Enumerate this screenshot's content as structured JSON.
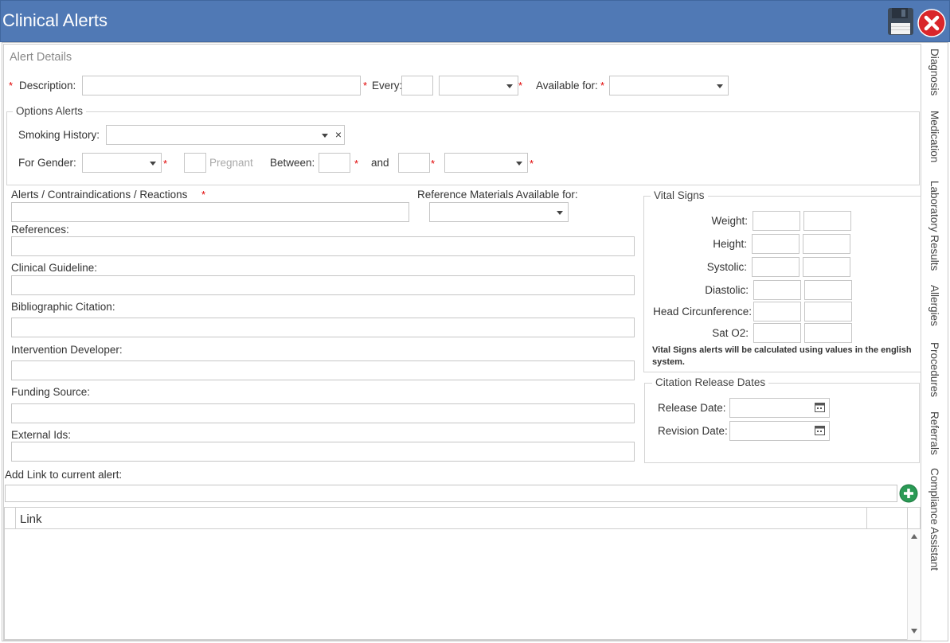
{
  "window": {
    "title": "Clinical Alerts"
  },
  "alert_details": {
    "heading": "Alert Details",
    "description_label": "Description:",
    "every_label": "Every:",
    "available_for_label": "Available for:",
    "required_mark": "*"
  },
  "options_alerts": {
    "legend": "Options Alerts",
    "smoking_history_label": "Smoking History:",
    "clear_symbol": "×",
    "for_gender_label": "For Gender:",
    "pregnant_label": "Pregnant",
    "between_label": "Between:",
    "and_label": "and"
  },
  "fields": {
    "alerts_label": "Alerts / Contraindications / Reactions",
    "reference_materials_label": "Reference Materials Available for:",
    "references_label": "References:",
    "clinical_guideline_label": "Clinical Guideline:",
    "bibliographic_label": "Bibliographic Citation:",
    "intervention_label": "Intervention Developer:",
    "funding_label": "Funding Source:",
    "external_ids_label": "External Ids:",
    "add_link_label": "Add Link to current alert:"
  },
  "vital_signs": {
    "legend": "Vital Signs",
    "rows": [
      "Weight:",
      "Height:",
      "Systolic:",
      "Diastolic:",
      "Head Circunference:",
      "Sat O2:"
    ],
    "note": "Vital Signs alerts will be calculated using values in the english system."
  },
  "citation_dates": {
    "legend": "Citation Release Dates",
    "release_label": "Release Date:",
    "revision_label": "Revision Date:"
  },
  "link_table": {
    "column_link": "Link"
  },
  "side_tabs": [
    "Diagnosis",
    "Medication",
    "Laboratory Results",
    "Allergies",
    "Procedures",
    "Referrals",
    "Compliance Assistant"
  ],
  "colors": {
    "titlebar": "#5079b5",
    "required": "#e00000",
    "close": "#d9262b",
    "add": "#2a9a55"
  },
  "icons": [
    "save-icon",
    "close-icon",
    "dropdown-arrow-icon",
    "calendar-icon",
    "add-link-icon",
    "scroll-up-icon",
    "scroll-down-icon"
  ]
}
